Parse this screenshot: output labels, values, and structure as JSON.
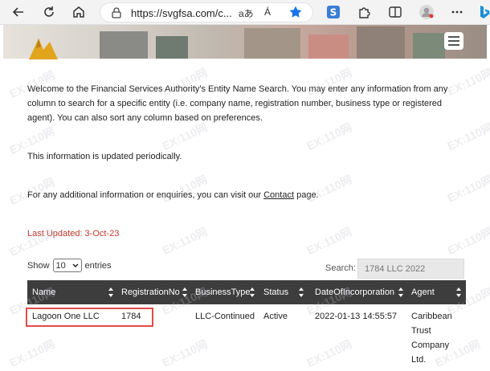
{
  "browser": {
    "url": "https://svgfsa.com/c...",
    "reader_text": "aあ",
    "read_aloud_text": "Á"
  },
  "page": {
    "intro": "Welcome to the Financial Services Authority's Entity Name Search. You may enter any information from any column to search for a specific entity (i.e. company name, registration number, business type or registered agent). You can also sort any column based on preferences.",
    "periodic": "This information is updated periodically.",
    "contact_prefix": "For any additional information or enquiries, you can visit our ",
    "contact_link": "Contact",
    "contact_suffix": " page.",
    "last_updated": "Last Updated:  3-Oct-23"
  },
  "table_controls": {
    "show_label": "Show",
    "show_value": "10",
    "entries_label": "entries",
    "search_label": "Search:",
    "search_value": "1784 LLC 2022"
  },
  "table": {
    "headers": [
      "Name",
      "RegistrationNo",
      "BusinessType",
      "Status",
      "DateOfIncorporation",
      "Agent"
    ],
    "rows": [
      {
        "name": "Lagoon One LLC",
        "registration_no": "1784",
        "business_type": "LLC-Continued",
        "status": "Active",
        "date": "2022-01-13 14:55:57",
        "agent_lines": [
          "Caribbean",
          "Trust",
          "Company",
          "Ltd."
        ]
      }
    ]
  },
  "watermark": "EX:110网",
  "colors": {
    "accent_red": "#c0392b",
    "table_header": "#3d3d3d",
    "highlight": "#e34a4a",
    "star_blue": "#1a73e8"
  }
}
